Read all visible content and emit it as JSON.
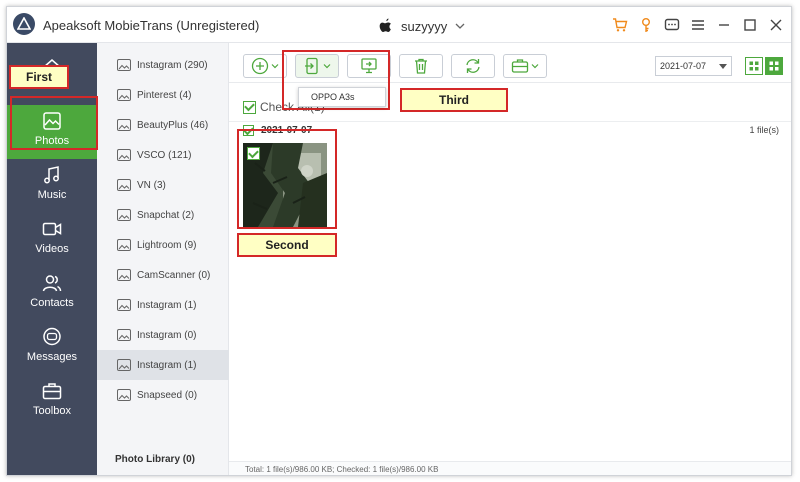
{
  "app": {
    "title": "Apeaksoft MobieTrans (Unregistered)",
    "device_name": "suzyyyy"
  },
  "titlebar_icons": [
    "cart-icon",
    "key-icon",
    "feedback-icon",
    "menu-icon",
    "minimize-icon",
    "maximize-icon",
    "close-icon"
  ],
  "nav": {
    "items": [
      {
        "key": "home",
        "label": ""
      },
      {
        "key": "photos",
        "label": "Photos",
        "active": true
      },
      {
        "key": "music",
        "label": "Music"
      },
      {
        "key": "videos",
        "label": "Videos"
      },
      {
        "key": "contacts",
        "label": "Contacts"
      },
      {
        "key": "messages",
        "label": "Messages"
      },
      {
        "key": "toolbox",
        "label": "Toolbox"
      }
    ]
  },
  "albums": {
    "items": [
      {
        "label": "Instagram (290)"
      },
      {
        "label": "Pinterest (4)"
      },
      {
        "label": "BeautyPlus (46)"
      },
      {
        "label": "VSCO (121)"
      },
      {
        "label": "VN (3)"
      },
      {
        "label": "Snapchat (2)"
      },
      {
        "label": "Lightroom (9)"
      },
      {
        "label": "CamScanner (0)"
      },
      {
        "label": "Instagram (1)"
      },
      {
        "label": "Instagram (0)"
      },
      {
        "label": "Instagram (1)",
        "active": true
      },
      {
        "label": "Snapseed (0)"
      }
    ],
    "photo_library": "Photo Library (0)"
  },
  "toolbar": {
    "date_value": "2021-07-07",
    "export_dropdown_item": "OPPO A3s"
  },
  "content": {
    "check_all_label": "Check All(1)",
    "group_date": "2021-07-07",
    "group_count": "1 file(s)"
  },
  "statusbar": {
    "text": "Total: 1 file(s)/986.00 KB; Checked: 1 file(s)/986.00 KB"
  },
  "annotations": {
    "first": "First",
    "second": "Second",
    "third": "Third"
  },
  "colors": {
    "accent_green": "#4da83d",
    "nav_bg": "#424a5e",
    "annotation_red": "#d42828",
    "callout_bg": "#ffffc4"
  }
}
